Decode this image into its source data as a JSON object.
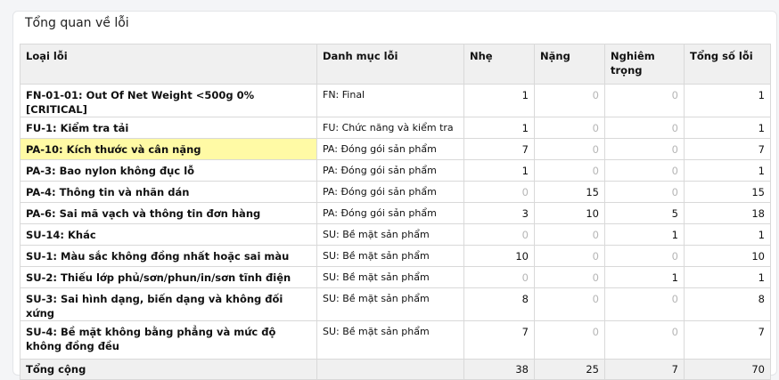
{
  "card": {
    "title": "Tổng quan về lỗi"
  },
  "table": {
    "headers": {
      "type": "Loại lỗi",
      "category": "Danh mục lỗi",
      "minor": "Nhẹ",
      "major": "Nặng",
      "critical": "Nghiêm trọng",
      "total": "Tổng số lỗi"
    },
    "rows": [
      {
        "type": "FN-01-01: Out Of Net Weight <500g 0% [CRITICAL]",
        "category": "FN: Final",
        "minor": "1",
        "major": "0",
        "critical": "0",
        "total": "1"
      },
      {
        "type": "FU-1: Kiểm tra tải",
        "category": "FU: Chức năng và kiểm tra",
        "minor": "1",
        "major": "0",
        "critical": "0",
        "total": "1"
      },
      {
        "type": "PA-10: Kích thước và cân nặng",
        "category": "PA: Đóng gói sản phẩm",
        "minor": "7",
        "major": "0",
        "critical": "0",
        "total": "7"
      },
      {
        "type": "PA-3: Bao nylon không đục lỗ",
        "category": "PA: Đóng gói sản phẩm",
        "minor": "1",
        "major": "0",
        "critical": "0",
        "total": "1"
      },
      {
        "type": "PA-4: Thông tin và nhãn dán",
        "category": "PA: Đóng gói sản phẩm",
        "minor": "0",
        "major": "15",
        "critical": "0",
        "total": "15"
      },
      {
        "type": "PA-6: Sai mã vạch và thông tin đơn hàng",
        "category": "PA: Đóng gói sản phẩm",
        "minor": "3",
        "major": "10",
        "critical": "5",
        "total": "18"
      },
      {
        "type": "SU-14: Khác",
        "category": "SU: Bề mặt sản phẩm",
        "minor": "0",
        "major": "0",
        "critical": "1",
        "total": "1"
      },
      {
        "type": "SU-1: Màu sắc không đồng nhất hoặc sai màu",
        "category": "SU: Bề mặt sản phẩm",
        "minor": "10",
        "major": "0",
        "critical": "0",
        "total": "10"
      },
      {
        "type": "SU-2: Thiếu lớp phủ/sơn/phun/in/sơn tĩnh điện",
        "category": "SU: Bề mặt sản phẩm",
        "minor": "0",
        "major": "0",
        "critical": "1",
        "total": "1"
      },
      {
        "type": "SU-3: Sai hình dạng, biến dạng và không đối xứng",
        "category": "SU: Bề mặt sản phẩm",
        "minor": "8",
        "major": "0",
        "critical": "0",
        "total": "8"
      },
      {
        "type": "SU-4: Bề mặt không bằng phẳng và mức độ không đồng đều",
        "category": "SU: Bề mặt sản phẩm",
        "minor": "7",
        "major": "0",
        "critical": "0",
        "total": "7"
      }
    ],
    "totals": {
      "label": "Tổng cộng",
      "minor": "38",
      "major": "25",
      "critical": "7",
      "total": "70"
    }
  },
  "colors": {
    "highlight": "#fffaa5",
    "header_bg": "#f0f0f0",
    "zero_text": "#b6b6b6"
  }
}
